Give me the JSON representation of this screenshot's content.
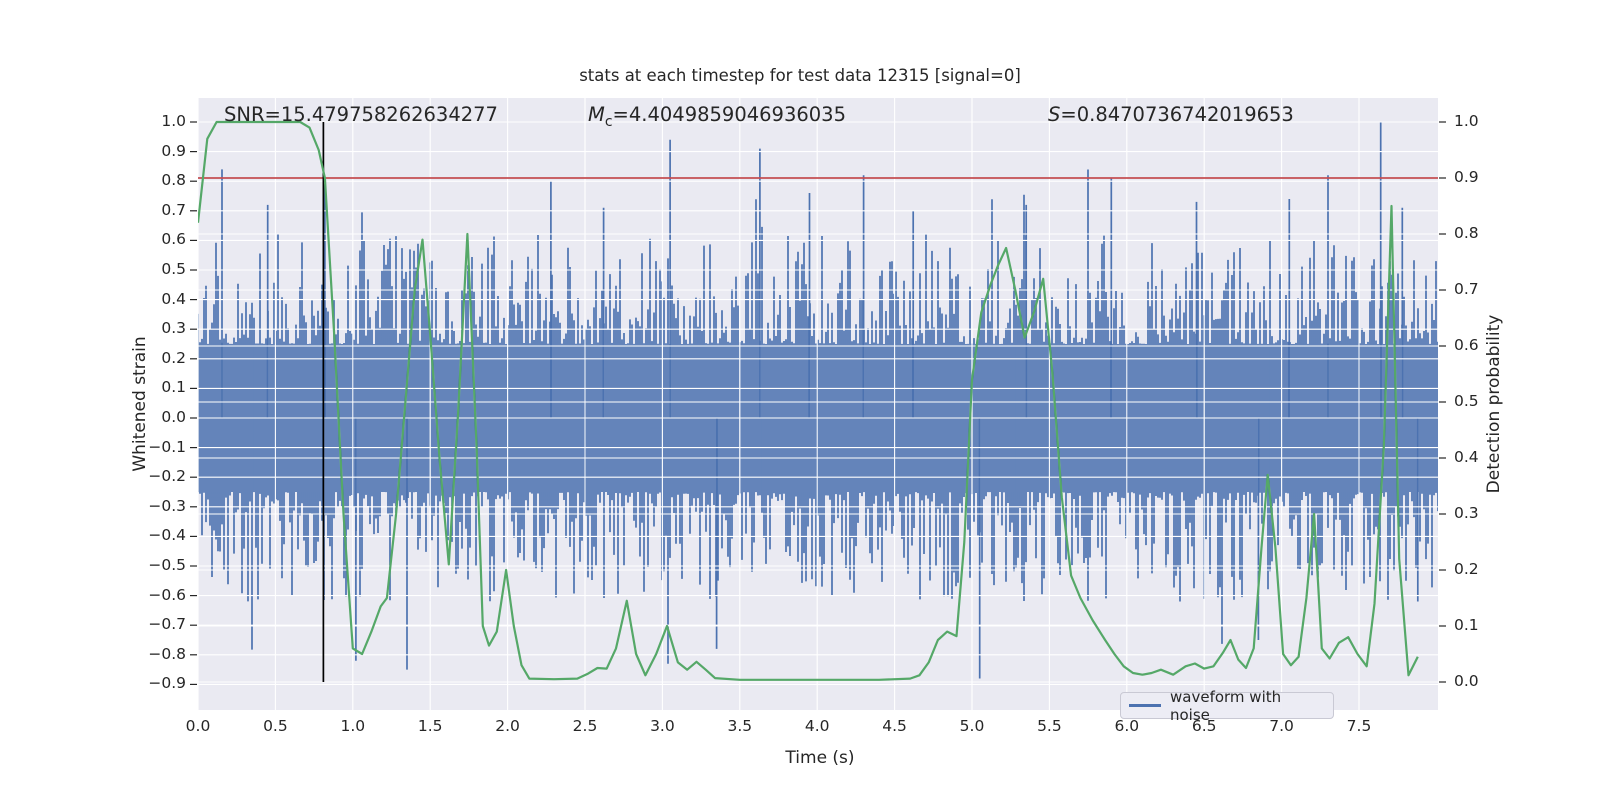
{
  "title": "stats at each timestep for test data 12315 [signal=0]",
  "annotations": {
    "snr": "SNR=15.479758262634277",
    "mc_symbol": "M",
    "mc_subscript": "c",
    "mc_value": "=4.4049859046936035",
    "s_symbol": "S",
    "s_value": "=0.8470736742019653"
  },
  "axis": {
    "x": {
      "label": "Time (s)",
      "tick_labels": [
        "0.0",
        "0.5",
        "1.0",
        "1.5",
        "2.0",
        "2.5",
        "3.0",
        "3.5",
        "4.0",
        "4.5",
        "5.0",
        "5.5",
        "6.0",
        "6.5",
        "7.0",
        "7.5"
      ],
      "tick_values": [
        0,
        0.5,
        1,
        1.5,
        2,
        2.5,
        3,
        3.5,
        4,
        4.5,
        5,
        5.5,
        6,
        6.5,
        7,
        7.5
      ]
    },
    "y_left": {
      "label": "Whitened strain",
      "tick_labels": [
        "1.0",
        "0.9",
        "0.8",
        "0.7",
        "0.6",
        "0.5",
        "0.4",
        "0.3",
        "0.2",
        "0.1",
        "0.0",
        "−0.1",
        "−0.2",
        "−0.3",
        "−0.4",
        "−0.5",
        "−0.6",
        "−0.7",
        "−0.8",
        "−0.9"
      ],
      "tick_values": [
        1.0,
        0.9,
        0.8,
        0.7,
        0.6,
        0.5,
        0.4,
        0.3,
        0.2,
        0.1,
        0.0,
        -0.1,
        -0.2,
        -0.3,
        -0.4,
        -0.5,
        -0.6,
        -0.7,
        -0.8,
        -0.9
      ]
    },
    "y_right": {
      "label": "Detection probability",
      "tick_labels": [
        "1.0",
        "0.9",
        "0.8",
        "0.7",
        "0.6",
        "0.5",
        "0.4",
        "0.3",
        "0.2",
        "0.1",
        "0.0"
      ],
      "tick_values": [
        1.0,
        0.9,
        0.8,
        0.7,
        0.6,
        0.5,
        0.4,
        0.3,
        0.2,
        0.1,
        0.0
      ]
    }
  },
  "legend": {
    "label": "waveform with noise"
  },
  "colors": {
    "plot_bg": "#EAEAF2",
    "grid": "#ffffff",
    "waveform": "#4C72B0",
    "probability": "#55A868",
    "threshold": "#C44E52",
    "event_line": "#000000",
    "text": "#262626"
  },
  "chart_data": {
    "type": "line",
    "title": "stats at each timestep for test data 12315 [signal=0]",
    "xlabel": "Time (s)",
    "ylabel_left": "Whitened strain",
    "ylabel_right": "Detection probability",
    "xlim": [
      0,
      8.0
    ],
    "ylim_left": [
      -0.99,
      1.08
    ],
    "ylim_right": [
      -0.046,
      1.043
    ],
    "grid": true,
    "legend_position": "lower right",
    "threshold_probability": 0.9,
    "event_time": 0.81,
    "series": [
      {
        "name": "waveform with noise",
        "axis": "left",
        "color": "#4C72B0",
        "style": "dense-noise",
        "noise_seed": 12315,
        "noise_columns": 620,
        "noise_core_amplitude": 0.25,
        "noise_typical_peak": 0.6,
        "feature_spikes": [
          [
            0.155,
            0.84
          ],
          [
            0.45,
            0.72
          ],
          [
            0.82,
            0.79
          ],
          [
            1.02,
            -0.82
          ],
          [
            1.35,
            -0.85
          ],
          [
            2.28,
            0.8
          ],
          [
            2.62,
            0.71
          ],
          [
            3.05,
            0.94
          ],
          [
            3.35,
            -0.78
          ],
          [
            3.63,
            0.91
          ],
          [
            3.95,
            0.76
          ],
          [
            4.3,
            0.82
          ],
          [
            4.62,
            0.7
          ],
          [
            5.05,
            -0.88
          ],
          [
            5.35,
            0.72
          ],
          [
            5.9,
            0.81
          ],
          [
            6.45,
            0.73
          ],
          [
            6.85,
            -0.75
          ],
          [
            7.05,
            0.74
          ],
          [
            7.3,
            0.82
          ],
          [
            7.64,
            1.0
          ],
          [
            7.78,
            0.71
          ],
          [
            7.88,
            -0.62
          ]
        ]
      },
      {
        "name": "detection probability",
        "axis": "right",
        "color": "#55A868",
        "style": "line",
        "points": [
          [
            0.0,
            0.82
          ],
          [
            0.06,
            0.97
          ],
          [
            0.12,
            1.0
          ],
          [
            0.2,
            1.0
          ],
          [
            0.3,
            1.0
          ],
          [
            0.4,
            1.0
          ],
          [
            0.5,
            1.0
          ],
          [
            0.6,
            1.0
          ],
          [
            0.66,
            1.0
          ],
          [
            0.72,
            0.99
          ],
          [
            0.78,
            0.95
          ],
          [
            0.82,
            0.9
          ],
          [
            0.88,
            0.62
          ],
          [
            0.94,
            0.3
          ],
          [
            1.0,
            0.06
          ],
          [
            1.06,
            0.05
          ],
          [
            1.12,
            0.09
          ],
          [
            1.18,
            0.135
          ],
          [
            1.22,
            0.15
          ],
          [
            1.28,
            0.3
          ],
          [
            1.34,
            0.5
          ],
          [
            1.4,
            0.7
          ],
          [
            1.45,
            0.79
          ],
          [
            1.5,
            0.62
          ],
          [
            1.56,
            0.4
          ],
          [
            1.62,
            0.21
          ],
          [
            1.68,
            0.48
          ],
          [
            1.74,
            0.8
          ],
          [
            1.8,
            0.42
          ],
          [
            1.84,
            0.1
          ],
          [
            1.88,
            0.065
          ],
          [
            1.93,
            0.09
          ],
          [
            1.99,
            0.2
          ],
          [
            2.04,
            0.1
          ],
          [
            2.09,
            0.03
          ],
          [
            2.14,
            0.006
          ],
          [
            2.3,
            0.005
          ],
          [
            2.45,
            0.006
          ],
          [
            2.52,
            0.015
          ],
          [
            2.58,
            0.025
          ],
          [
            2.64,
            0.024
          ],
          [
            2.7,
            0.06
          ],
          [
            2.77,
            0.145
          ],
          [
            2.83,
            0.05
          ],
          [
            2.89,
            0.012
          ],
          [
            2.96,
            0.05
          ],
          [
            3.03,
            0.1
          ],
          [
            3.1,
            0.035
          ],
          [
            3.16,
            0.022
          ],
          [
            3.22,
            0.036
          ],
          [
            3.28,
            0.022
          ],
          [
            3.34,
            0.007
          ],
          [
            3.5,
            0.004
          ],
          [
            3.8,
            0.004
          ],
          [
            4.1,
            0.004
          ],
          [
            4.4,
            0.004
          ],
          [
            4.6,
            0.006
          ],
          [
            4.66,
            0.012
          ],
          [
            4.72,
            0.035
          ],
          [
            4.78,
            0.075
          ],
          [
            4.84,
            0.09
          ],
          [
            4.9,
            0.082
          ],
          [
            4.95,
            0.25
          ],
          [
            5.0,
            0.54
          ],
          [
            5.06,
            0.66
          ],
          [
            5.12,
            0.71
          ],
          [
            5.17,
            0.745
          ],
          [
            5.22,
            0.775
          ],
          [
            5.28,
            0.7
          ],
          [
            5.34,
            0.615
          ],
          [
            5.4,
            0.66
          ],
          [
            5.46,
            0.72
          ],
          [
            5.52,
            0.55
          ],
          [
            5.58,
            0.33
          ],
          [
            5.64,
            0.19
          ],
          [
            5.7,
            0.15
          ],
          [
            5.78,
            0.11
          ],
          [
            5.86,
            0.075
          ],
          [
            5.92,
            0.05
          ],
          [
            5.98,
            0.028
          ],
          [
            6.04,
            0.016
          ],
          [
            6.1,
            0.013
          ],
          [
            6.16,
            0.016
          ],
          [
            6.22,
            0.022
          ],
          [
            6.3,
            0.013
          ],
          [
            6.38,
            0.028
          ],
          [
            6.44,
            0.033
          ],
          [
            6.5,
            0.024
          ],
          [
            6.56,
            0.028
          ],
          [
            6.62,
            0.052
          ],
          [
            6.67,
            0.075
          ],
          [
            6.72,
            0.04
          ],
          [
            6.77,
            0.025
          ],
          [
            6.82,
            0.06
          ],
          [
            6.87,
            0.24
          ],
          [
            6.91,
            0.37
          ],
          [
            6.96,
            0.24
          ],
          [
            7.01,
            0.05
          ],
          [
            7.06,
            0.03
          ],
          [
            7.11,
            0.045
          ],
          [
            7.16,
            0.15
          ],
          [
            7.21,
            0.3
          ],
          [
            7.26,
            0.06
          ],
          [
            7.31,
            0.042
          ],
          [
            7.37,
            0.07
          ],
          [
            7.43,
            0.08
          ],
          [
            7.49,
            0.05
          ],
          [
            7.55,
            0.028
          ],
          [
            7.6,
            0.14
          ],
          [
            7.66,
            0.42
          ],
          [
            7.71,
            0.85
          ],
          [
            7.76,
            0.22
          ],
          [
            7.82,
            0.012
          ],
          [
            7.88,
            0.045
          ]
        ]
      },
      {
        "name": "threshold",
        "axis": "right",
        "color": "#C44E52",
        "style": "hline",
        "value": 0.9
      },
      {
        "name": "event marker",
        "axis": "x",
        "color": "#000000",
        "style": "vline",
        "value": 0.81
      }
    ]
  }
}
